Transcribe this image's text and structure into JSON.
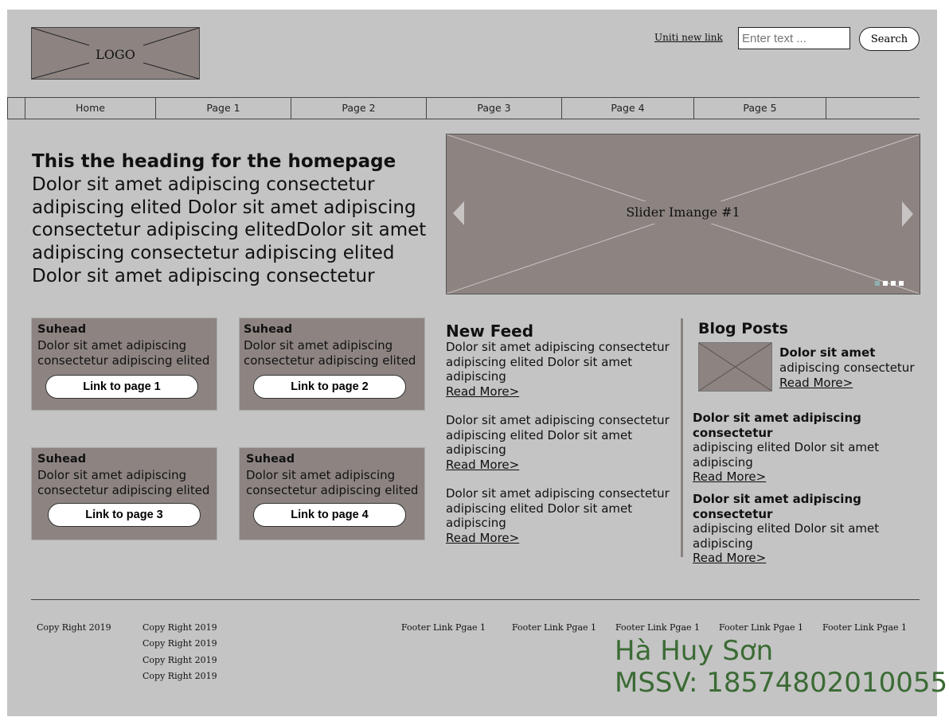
{
  "header": {
    "logo_label": "LOGO",
    "link_label": "Uniti new link",
    "search_placeholder": "Enter text ...",
    "search_label": "Search"
  },
  "nav": {
    "items": [
      "Home",
      "Page 1",
      "Page 2",
      "Page 3",
      "Page 4",
      "Page 5"
    ]
  },
  "hero": {
    "heading": "This the heading for the homepage",
    "text": "Dolor sit amet adipiscing consectetur adipiscing elited Dolor sit amet adipiscing consectetur adipiscing elitedDolor sit amet adipiscing consectetur adipiscing elited Dolor sit amet adipiscing consectetur"
  },
  "slider": {
    "caption": "Slider Imange #1",
    "prev_icon": "triangle-left-icon",
    "next_icon": "triangle-right-icon",
    "dot_count": 4,
    "active_dot": 1
  },
  "cards": [
    {
      "title": "Suhead",
      "text": "Dolor sit amet adipiscing consectetur adipiscing elited",
      "button": "Link to page 1"
    },
    {
      "title": "Suhead",
      "text": "Dolor sit amet adipiscing consectetur adipiscing elited",
      "button": "Link to page 2"
    },
    {
      "title": "Suhead",
      "text": "Dolor sit amet adipiscing consectetur adipiscing elited",
      "button": "Link to page 3"
    },
    {
      "title": "Suhead",
      "text": "Dolor sit amet adipiscing consectetur adipiscing elited",
      "button": "Link to page 4"
    }
  ],
  "feed": {
    "heading": "New Feed",
    "items": [
      {
        "text": "Dolor sit amet adipiscing consectetur adipiscing elited Dolor sit amet adipiscing",
        "link": "Read More>"
      },
      {
        "text": "Dolor sit amet adipiscing consectetur adipiscing elited Dolor sit amet adipiscing",
        "link": "Read More>"
      },
      {
        "text": "Dolor sit amet adipiscing consectetur adipiscing elited Dolor sit amet adipiscing",
        "link": "Read More>"
      }
    ]
  },
  "blog": {
    "heading": "Blog Posts",
    "featured": {
      "title": "Dolor sit amet",
      "text": "adipiscing consectetur",
      "link": "Read More>"
    },
    "items": [
      {
        "title": "Dolor sit amet adipiscing consectetur",
        "text": "adipiscing elited Dolor sit amet adipiscing",
        "link": "Read More>"
      },
      {
        "title": "Dolor sit amet adipiscing consectetur",
        "text": "adipiscing elited Dolor sit amet adipiscing",
        "link": "Read More>"
      }
    ]
  },
  "footer": {
    "copyright": "Copy Right 2019",
    "col2": [
      "Copy Right 2019",
      "Copy Right 2019",
      "Copy Right 2019",
      "Copy Right 2019"
    ],
    "links": [
      "Footer Link Pgae 1",
      "Footer Link Pgae 1",
      "Footer Link Pgae 1",
      "Footer Link Pgae 1",
      "Footer Link Pgae 1"
    ]
  },
  "author": {
    "name": "Hà Huy Sơn",
    "id": "MSSV: 18574802010055"
  }
}
